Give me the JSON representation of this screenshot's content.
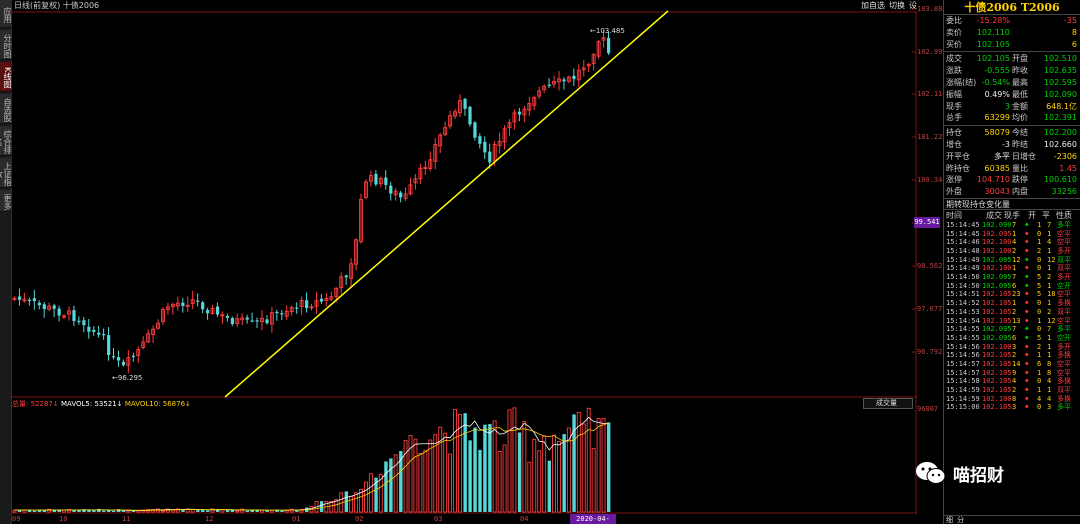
{
  "header": {
    "title": "日线(前复权) 十债2006",
    "tools": [
      "加自选",
      "切换",
      "设"
    ]
  },
  "left_tabs": [
    "应用",
    "分时图",
    "K线图",
    "自选股",
    "综合排名",
    "上证指数",
    "更多"
  ],
  "left_tab_active": 2,
  "y_axis": {
    "labels": [
      "103.884",
      "102.999",
      "102.114",
      "101.229",
      "100.344",
      "99.541",
      "98.562",
      "97.677",
      "96.792"
    ],
    "current_price": "99.541"
  },
  "annotations": {
    "high": "103.485",
    "low": "96.295"
  },
  "volume": {
    "label_vol": "总量: 52287↓",
    "label_ma5": "MAVOL5: 53521↓",
    "label_ma10": "MAVOL10: 56876↓",
    "dropdown": "成交量",
    "top_value": "96807"
  },
  "x_axis": {
    "labels": [
      "09",
      "10",
      "11",
      "12",
      "01",
      "02",
      "03",
      "04"
    ],
    "highlight": "2020-04-21/二"
  },
  "colors": {
    "up": "#ff3c3c",
    "down": "#54d8d8",
    "trend": "#ffff00",
    "ma5": "#ffffff",
    "ma10": "#ffd200"
  },
  "quote": {
    "title": "十债2006 T2006",
    "rows": [
      {
        "l": "委比",
        "v": "-15.28%",
        "vc": "red",
        "l2": "",
        "v2": "-35",
        "v2c": "red"
      },
      {
        "l": "卖价",
        "v": "102.110",
        "vc": "green",
        "l2": "",
        "v2": "8",
        "v2c": "yellow"
      },
      {
        "l": "买价",
        "v": "102.105",
        "vc": "green",
        "l2": "",
        "v2": "6",
        "v2c": "yellow"
      },
      {
        "sep": true
      },
      {
        "l": "成交",
        "v": "102.105",
        "vc": "green",
        "l2": "开盘",
        "v2": "102.510",
        "v2c": "green"
      },
      {
        "l": "涨跌",
        "v": "-0.555",
        "vc": "green",
        "l2": "昨收",
        "v2": "102.635",
        "v2c": "green"
      },
      {
        "l": "涨幅(结)",
        "v": "-0.54%",
        "vc": "green",
        "l2": "最高",
        "v2": "102.595",
        "v2c": "green"
      },
      {
        "l": "振幅",
        "v": "0.49%",
        "vc": "white",
        "l2": "最低",
        "v2": "102.090",
        "v2c": "green"
      },
      {
        "l": "现手",
        "v": "3",
        "vc": "green",
        "l2": "金额",
        "v2": "648.1亿",
        "v2c": "yellow"
      },
      {
        "l": "总手",
        "v": "63299",
        "vc": "yellow",
        "l2": "均价",
        "v2": "102.391",
        "v2c": "green"
      },
      {
        "sep": true
      },
      {
        "l": "持仓",
        "v": "58079",
        "vc": "yellow",
        "l2": "今结",
        "v2": "102.200",
        "v2c": "green"
      },
      {
        "l": "增仓",
        "v": "-3",
        "vc": "white",
        "l2": "昨结",
        "v2": "102.660",
        "v2c": "white"
      },
      {
        "l": "开平仓",
        "v": "多平",
        "vc": "white",
        "l2": "日增仓",
        "v2": "-2306",
        "v2c": "yellow"
      },
      {
        "l": "昨持仓",
        "v": "60385",
        "vc": "yellow",
        "l2": "量比",
        "v2": "1.45",
        "v2c": "red"
      },
      {
        "l": "涨停",
        "v": "104.710",
        "vc": "red",
        "l2": "跌停",
        "v2": "100.610",
        "v2c": "green"
      },
      {
        "l": "外盘",
        "v": "30043",
        "vc": "red",
        "l2": "内盘",
        "v2": "33256",
        "v2c": "green"
      }
    ]
  },
  "hold_title": "期转现持仓变化量",
  "tick_head": [
    "时间",
    "成交",
    "现手",
    "开",
    "平",
    "性质"
  ],
  "ticks": [
    {
      "t": "15:14:45",
      "p": "102.090",
      "n": "7",
      "d": "down",
      "o": "1",
      "c": "7",
      "k": "多平",
      "kc": "green"
    },
    {
      "t": "15:14:45",
      "p": "102.095",
      "n": "1",
      "d": "up",
      "o": "0",
      "c": "1",
      "k": "空平",
      "kc": "red"
    },
    {
      "t": "15:14:46",
      "p": "102.100",
      "n": "4",
      "d": "up",
      "o": "1",
      "c": "4",
      "k": "空平",
      "kc": "red"
    },
    {
      "t": "15:14:48",
      "p": "102.100",
      "n": "2",
      "d": "up",
      "o": "2",
      "c": "1",
      "k": "多开",
      "kc": "red"
    },
    {
      "t": "15:14:49",
      "p": "102.095",
      "n": "12",
      "d": "down",
      "o": "0",
      "c": "12",
      "k": "双平",
      "kc": "green"
    },
    {
      "t": "15:14:49",
      "p": "102.100",
      "n": "1",
      "d": "up",
      "o": "0",
      "c": "1",
      "k": "双平",
      "kc": "red"
    },
    {
      "t": "15:14:50",
      "p": "102.095",
      "n": "7",
      "d": "down",
      "o": "5",
      "c": "2",
      "k": "多开",
      "kc": "red"
    },
    {
      "t": "15:14:50",
      "p": "102.095",
      "n": "6",
      "d": "down",
      "o": "5",
      "c": "1",
      "k": "空开",
      "kc": "green"
    },
    {
      "t": "15:14:51",
      "p": "102.105",
      "n": "23",
      "d": "up",
      "o": "5",
      "c": "18",
      "k": "空平",
      "kc": "red"
    },
    {
      "t": "15:14:52",
      "p": "102.105",
      "n": "1",
      "d": "up",
      "o": "0",
      "c": "1",
      "k": "多换",
      "kc": "red"
    },
    {
      "t": "15:14:53",
      "p": "102.105",
      "n": "2",
      "d": "up",
      "o": "0",
      "c": "2",
      "k": "双平",
      "kc": "red"
    },
    {
      "t": "15:14:54",
      "p": "102.105",
      "n": "13",
      "d": "up",
      "o": "1",
      "c": "12",
      "k": "空平",
      "kc": "red"
    },
    {
      "t": "15:14:55",
      "p": "102.095",
      "n": "7",
      "d": "down",
      "o": "0",
      "c": "7",
      "k": "多平",
      "kc": "green"
    },
    {
      "t": "15:14:55",
      "p": "102.095",
      "n": "6",
      "d": "down",
      "o": "5",
      "c": "1",
      "k": "空开",
      "kc": "green"
    },
    {
      "t": "15:14:56",
      "p": "102.100",
      "n": "3",
      "d": "up",
      "o": "2",
      "c": "1",
      "k": "多开",
      "kc": "red"
    },
    {
      "t": "15:14:56",
      "p": "102.105",
      "n": "2",
      "d": "up",
      "o": "1",
      "c": "1",
      "k": "多换",
      "kc": "red"
    },
    {
      "t": "15:14:57",
      "p": "102.105",
      "n": "14",
      "d": "up",
      "o": "6",
      "c": "8",
      "k": "空平",
      "kc": "red"
    },
    {
      "t": "15:14:57",
      "p": "102.105",
      "n": "9",
      "d": "up",
      "o": "1",
      "c": "8",
      "k": "空平",
      "kc": "red"
    },
    {
      "t": "15:14:58",
      "p": "102.105",
      "n": "4",
      "d": "up",
      "o": "0",
      "c": "4",
      "k": "多换",
      "kc": "red"
    },
    {
      "t": "15:14:59",
      "p": "102.105",
      "n": "2",
      "d": "up",
      "o": "1",
      "c": "1",
      "k": "双平",
      "kc": "red"
    },
    {
      "t": "15:14:59",
      "p": "102.100",
      "n": "8",
      "d": "up",
      "o": "4",
      "c": "4",
      "k": "多换",
      "kc": "red"
    },
    {
      "t": "15:15:00",
      "p": "102.105",
      "n": "3",
      "d": "up",
      "o": "0",
      "c": "3",
      "k": "多平",
      "kc": "green"
    }
  ],
  "bottom_tabs": [
    "细",
    "分"
  ],
  "watermark": "喵招财"
}
